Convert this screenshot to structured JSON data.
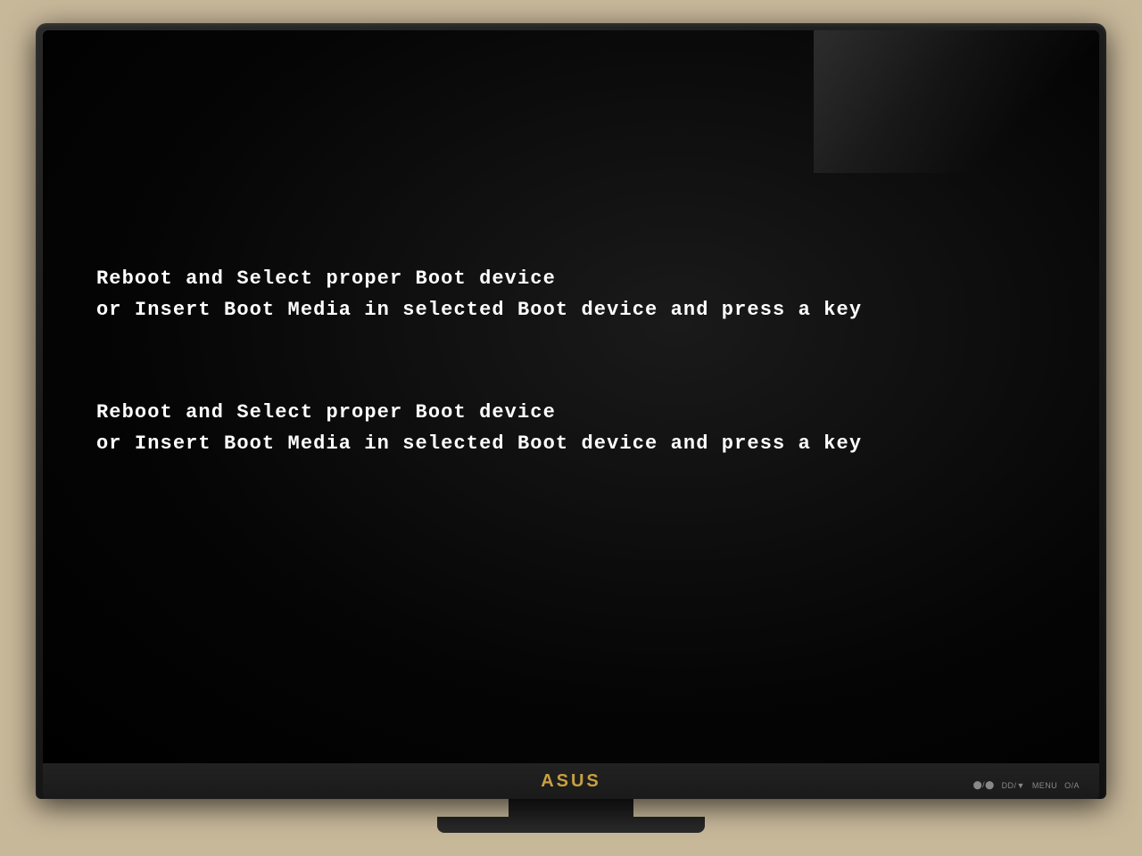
{
  "monitor": {
    "brand": "ASUS",
    "controls": [
      {
        "label": ""
      },
      {
        "label": "DD/▼"
      },
      {
        "label": "MENU"
      },
      {
        "label": "O/A"
      }
    ]
  },
  "screen": {
    "background_color": "#000000",
    "error_messages": [
      {
        "id": "error-1",
        "line1": "Reboot and Select proper Boot device",
        "line2": "or Insert Boot Media in selected Boot device and press a key"
      },
      {
        "id": "error-2",
        "line1": "Reboot and Select proper Boot device",
        "line2": "or Insert Boot Media in selected Boot device and press a key"
      }
    ]
  }
}
